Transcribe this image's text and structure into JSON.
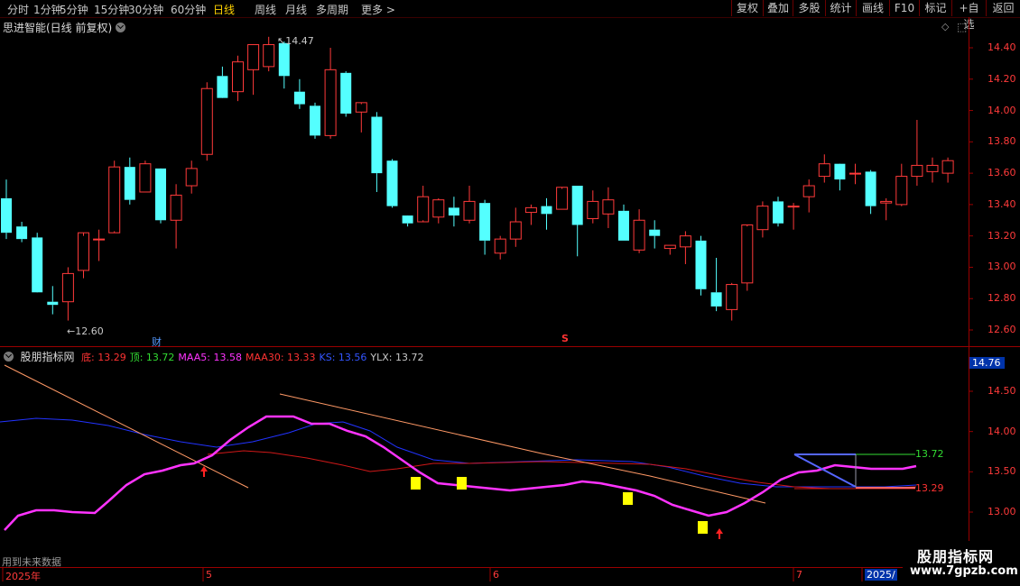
{
  "toolbar": {
    "periods": [
      "分时",
      "1分钟",
      "5分钟",
      "15分钟",
      "30分钟",
      "60分钟",
      "日线",
      "周线",
      "月线",
      "多周期",
      "更多 >"
    ],
    "active_period": "日线",
    "right_buttons": [
      "复权",
      "叠加",
      "多股",
      "统计",
      "画线",
      "F10",
      "标记",
      "+自选",
      "返回"
    ]
  },
  "main_chart": {
    "title": "思进智能(日线 前复权)",
    "high_label": "14.47",
    "low_label": "12.60",
    "marker_cai": "财",
    "marker_s": "S",
    "y_ticks": [
      "14.40",
      "14.20",
      "14.00",
      "13.80",
      "13.60",
      "13.40",
      "13.20",
      "13.00",
      "12.80",
      "12.60"
    ],
    "candles": [
      [
        13.44,
        13.56,
        13.18,
        13.22
      ],
      [
        13.26,
        13.29,
        13.16,
        13.18
      ],
      [
        13.19,
        13.22,
        12.89,
        12.84
      ],
      [
        12.78,
        12.88,
        12.7,
        12.76
      ],
      [
        12.78,
        13.0,
        12.66,
        12.96
      ],
      [
        12.98,
        13.2,
        12.93,
        13.22
      ],
      [
        13.18,
        13.24,
        13.04,
        13.18
      ],
      [
        13.22,
        13.68,
        13.23,
        13.64
      ],
      [
        13.64,
        13.7,
        13.4,
        13.43
      ],
      [
        13.48,
        13.68,
        13.48,
        13.66
      ],
      [
        13.63,
        13.62,
        13.28,
        13.3
      ],
      [
        13.3,
        13.53,
        13.12,
        13.46
      ],
      [
        13.52,
        13.68,
        13.47,
        13.63
      ],
      [
        13.72,
        14.18,
        13.68,
        14.14
      ],
      [
        14.22,
        14.28,
        14.12,
        14.08
      ],
      [
        14.12,
        14.35,
        14.06,
        14.31
      ],
      [
        14.26,
        14.42,
        14.1,
        14.42
      ],
      [
        14.28,
        14.47,
        14.25,
        14.42
      ],
      [
        14.43,
        14.44,
        14.14,
        14.22
      ],
      [
        14.12,
        14.2,
        14.01,
        14.04
      ],
      [
        14.03,
        14.05,
        13.82,
        13.84
      ],
      [
        13.84,
        14.4,
        13.82,
        14.26
      ],
      [
        14.24,
        14.25,
        13.96,
        13.98
      ],
      [
        13.99,
        14.04,
        13.86,
        14.05
      ],
      [
        13.96,
        13.99,
        13.48,
        13.6
      ],
      [
        13.68,
        13.69,
        13.38,
        13.39
      ],
      [
        13.33,
        13.3,
        13.26,
        13.28
      ],
      [
        13.29,
        13.52,
        13.3,
        13.45
      ],
      [
        13.32,
        13.44,
        13.28,
        13.43
      ],
      [
        13.38,
        13.45,
        13.26,
        13.33
      ],
      [
        13.3,
        13.52,
        13.28,
        13.42
      ],
      [
        13.41,
        13.43,
        13.08,
        13.17
      ],
      [
        13.09,
        13.2,
        13.05,
        13.18
      ],
      [
        13.18,
        13.38,
        13.13,
        13.29
      ],
      [
        13.35,
        13.4,
        13.27,
        13.38
      ],
      [
        13.39,
        13.44,
        13.24,
        13.34
      ],
      [
        13.37,
        13.5,
        13.37,
        13.51
      ],
      [
        13.52,
        13.52,
        13.07,
        13.27
      ],
      [
        13.31,
        13.49,
        13.28,
        13.42
      ],
      [
        13.34,
        13.51,
        13.25,
        13.43
      ],
      [
        13.36,
        13.4,
        13.17,
        13.17
      ],
      [
        13.11,
        13.37,
        13.09,
        13.3
      ],
      [
        13.24,
        13.3,
        13.12,
        13.2
      ],
      [
        13.12,
        13.14,
        13.08,
        13.14
      ],
      [
        13.13,
        13.23,
        13.02,
        13.2
      ],
      [
        13.17,
        13.2,
        12.82,
        12.86
      ],
      [
        12.84,
        13.06,
        12.72,
        12.75
      ],
      [
        12.73,
        12.9,
        12.66,
        12.89
      ],
      [
        12.9,
        13.26,
        12.85,
        13.27
      ],
      [
        13.24,
        13.42,
        13.19,
        13.39
      ],
      [
        13.42,
        13.45,
        13.26,
        13.28
      ],
      [
        13.39,
        13.41,
        13.24,
        13.39
      ],
      [
        13.45,
        13.56,
        13.35,
        13.52
      ],
      [
        13.58,
        13.72,
        13.54,
        13.66
      ],
      [
        13.66,
        13.64,
        13.49,
        13.56
      ],
      [
        13.6,
        13.66,
        13.53,
        13.6
      ],
      [
        13.61,
        13.62,
        13.34,
        13.39
      ],
      [
        13.41,
        13.44,
        13.3,
        13.42
      ],
      [
        13.4,
        13.66,
        13.39,
        13.58
      ],
      [
        13.58,
        13.94,
        13.52,
        13.65
      ],
      [
        13.61,
        13.7,
        13.54,
        13.65
      ],
      [
        13.6,
        13.7,
        13.54,
        13.68
      ]
    ]
  },
  "indicator": {
    "name": "股朋指标网",
    "items": [
      {
        "label": "底:",
        "value": "13.29",
        "color": "#ff3333"
      },
      {
        "label": "顶:",
        "value": "13.72",
        "color": "#33dd33"
      },
      {
        "label": "MAA5:",
        "value": "13.58",
        "color": "#ff33ff"
      },
      {
        "label": "MAA30:",
        "value": "13.33",
        "color": "#ff3333"
      },
      {
        "label": "KS:",
        "value": "13.56",
        "color": "#3355ff"
      },
      {
        "label": "YLX:",
        "value": "13.72",
        "color": "#c8c8c8"
      }
    ],
    "y_ticks": [
      "14.76",
      "14.50",
      "14.00",
      "13.50",
      "13.00"
    ],
    "label_top": "13.72",
    "label_bottom": "13.29",
    "future_note": "用到未来数据"
  },
  "x_axis": {
    "labels": [
      "2025年",
      "5",
      "6",
      "7",
      "2025/"
    ]
  },
  "watermark": {
    "line1": "股朋指标网",
    "line2": "www.7gpzb.com"
  },
  "colors": {
    "up": "#ff3a3a",
    "down": "#54ffff",
    "magenta": "#ff33ff",
    "blue": "#2233ff",
    "red": "#d01818",
    "orange": "#ff9966",
    "yellow": "#ffff00"
  }
}
